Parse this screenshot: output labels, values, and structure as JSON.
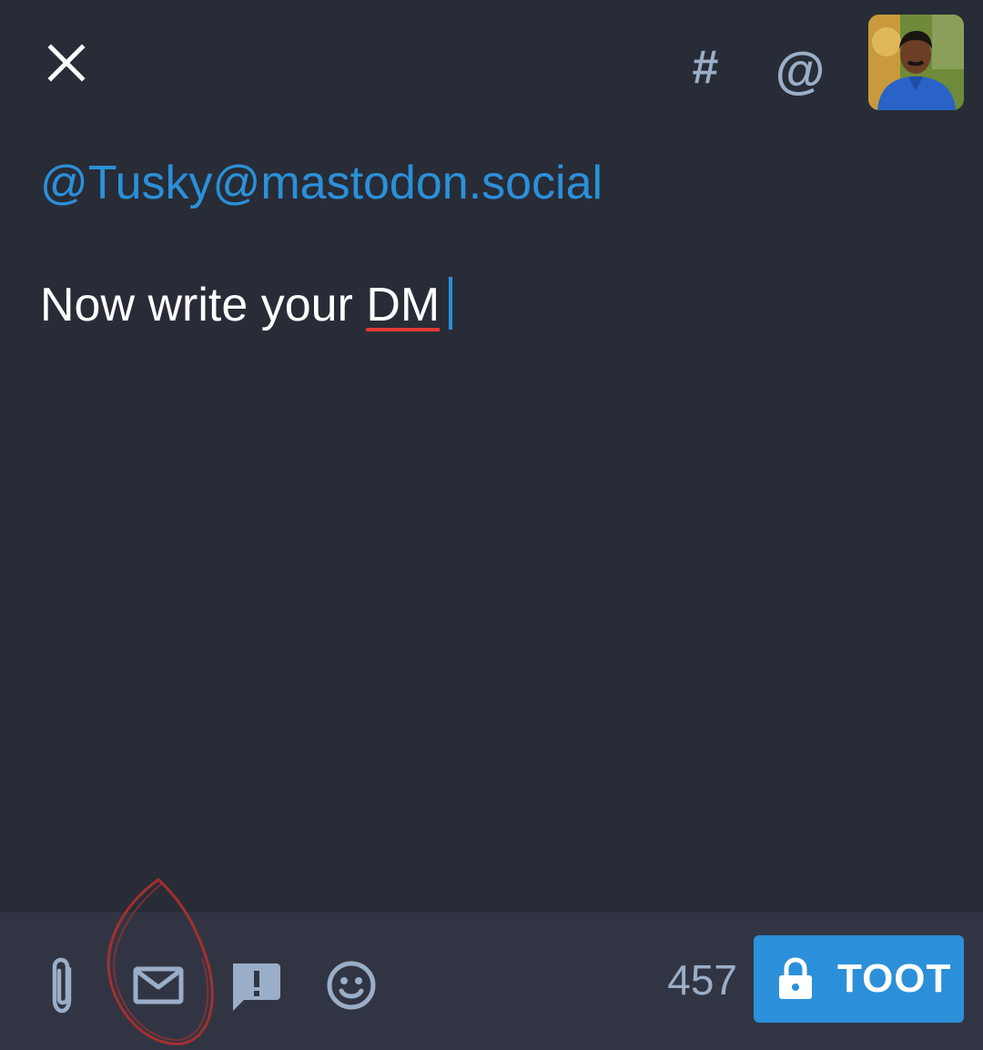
{
  "header": {
    "close_icon": "close-icon",
    "hashtag_label": "#",
    "mention_label": "@",
    "avatar_icon": "profile-avatar"
  },
  "compose": {
    "mention": "@Tusky@mastodon.social",
    "text_before": "Now write your ",
    "text_misspelled": "DM"
  },
  "toolbar": {
    "attach_icon": "paperclip-icon",
    "visibility_icon": "envelope-icon",
    "content_warning_icon": "content-warning-icon",
    "emoji_icon": "emoji-icon",
    "char_count": "457",
    "toot_label": "TOOT",
    "toot_icon": "lock-icon"
  },
  "colors": {
    "background": "#282c37",
    "toolbar_background": "#313543",
    "accent": "#2b90d9",
    "icon": "#9baec8",
    "text": "#ffffff",
    "spellcheck_underline": "#e53935",
    "annotation": "#b03030"
  }
}
